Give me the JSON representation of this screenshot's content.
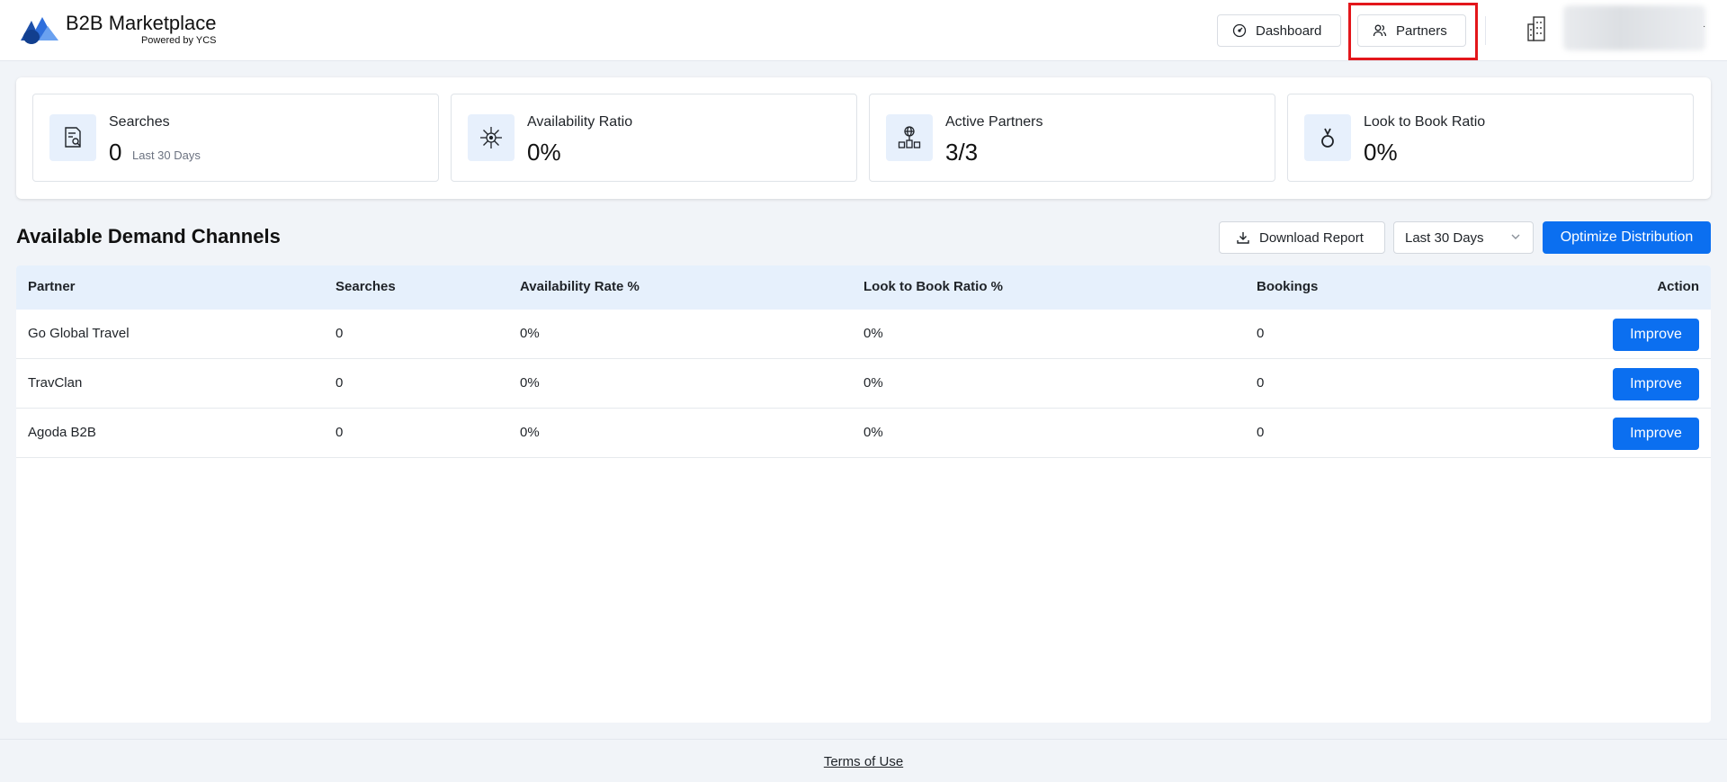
{
  "brand": {
    "title": "B2B Marketplace",
    "subtitle": "Powered by YCS",
    "logo_icon": "ycs-logo-icon"
  },
  "nav": {
    "dashboard_label": "Dashboard",
    "partners_label": "Partners",
    "dashboard_icon": "gauge-icon",
    "partners_icon": "users-icon"
  },
  "account": {
    "icon": "building-icon"
  },
  "stats": [
    {
      "label": "Searches",
      "value": "0",
      "sub": "Last 30 Days",
      "icon": "search-document-icon"
    },
    {
      "label": "Availability Ratio",
      "value": "0%",
      "icon": "virus-network-icon"
    },
    {
      "label": "Active Partners",
      "value": "3/3",
      "icon": "globe-network-icon"
    },
    {
      "label": "Look to Book Ratio",
      "value": "0%",
      "icon": "ring-icon"
    }
  ],
  "section": {
    "title": "Available Demand Channels",
    "download_label": "Download Report",
    "period_value": "Last 30 Days",
    "optimize_label": "Optimize Distribution"
  },
  "table": {
    "columns": [
      "Partner",
      "Searches",
      "Availability Rate %",
      "Look to Book Ratio %",
      "Bookings",
      "Action"
    ],
    "rows": [
      {
        "partner": "Go Global Travel",
        "searches": "0",
        "availability": "0%",
        "l2b": "0%",
        "bookings": "0",
        "action": "Improve"
      },
      {
        "partner": "TravClan",
        "searches": "0",
        "availability": "0%",
        "l2b": "0%",
        "bookings": "0",
        "action": "Improve"
      },
      {
        "partner": "Agoda B2B",
        "searches": "0",
        "availability": "0%",
        "l2b": "0%",
        "bookings": "0",
        "action": "Improve"
      }
    ]
  },
  "footer": {
    "terms_label": "Terms of Use"
  },
  "colors": {
    "primary": "#0b6ff0",
    "highlight": "#e3161b",
    "header_row": "#e6f0fc",
    "icon_bg": "#e7f0fc"
  }
}
